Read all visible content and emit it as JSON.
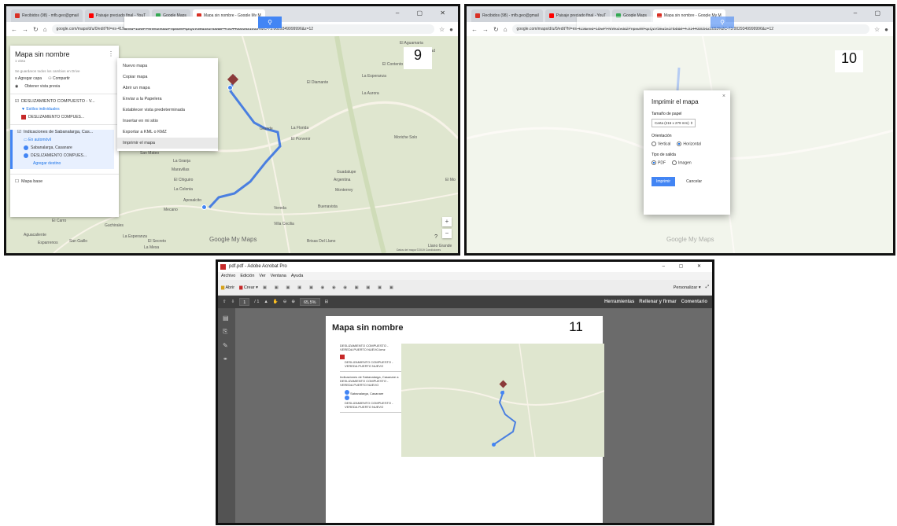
{
  "tabs": {
    "gmail": "Recibidos (98) - mfb.geo@gmail",
    "youtube": "Paisaje preciado final - YouT",
    "maps": "Google Maps",
    "mymaps": "Mapa sin nombre - Google My M"
  },
  "url": "google.com/maps/d/u/0/edit?hl=es-419&mid=1BwPFMWo2vdd2PnpsuWFqzQzV5Eu5s1Hb8&ll=4.91440805621053%2C-73.0029349999996&z=12",
  "shot9": {
    "number": "9",
    "panel": {
      "title": "Mapa sin nombre",
      "views": "1 vista",
      "saved": "Se guardaron todos los cambios en Drive",
      "add_layer": "Agregar capa",
      "share": "Compartir",
      "preview": "Obtener vista previa",
      "layer1": "DESLIZAMIENTO COMPUESTO - V...",
      "layer1_style": "Estilos individuales",
      "layer1_item": "DESLIZAMIENTO COMPUES...",
      "layer2": "Indicaciones de Sabanalarga, Cas...",
      "layer2_mode": "En automóvil",
      "layer2_a": "Sabanalarga, Casanare",
      "layer2_b": "DESLIZAMIENTO COMPUES...",
      "add_dest": "Agregar destino",
      "base": "Mapa base"
    },
    "menu": [
      "Nuevo mapa",
      "Copiar mapa",
      "Abrir un mapa",
      "Enviar a la Papelera",
      "Establecer vista predeterminada",
      "Insertar en mi sitio",
      "Exportar a KML o KMZ",
      "Imprimir el mapa"
    ],
    "map_labels": {
      "aguamaria": "El Aguamaria",
      "contento": "El Contento",
      "esperanza": "La Esperanza",
      "diamante": "El Diamante",
      "aurora": "La Aurora",
      "florida": "La Florida",
      "porvenir": "El Porvenir",
      "morichesolo": "Moriche Solo",
      "sanmateo": "San Mateo",
      "granja": "La Granja",
      "maravillas": "Maravillas",
      "chiquero": "El Chiguiro",
      "colonia": "La Colonia",
      "guadalupe": "Guadalupe",
      "argentina": "Argentina",
      "monterrey": "Monterrey",
      "grande": "Grande",
      "mirador": "Mecano",
      "vereda": "Vereda",
      "buenavista": "Buenavista",
      "elcarro": "El Carro",
      "aguacaliente": "Aguacaliente",
      "esparrenos": "Esparrenos",
      "guchirales": "Guchirales",
      "sangaller": "San Gaillo",
      "lamesa": "La Mesa",
      "secreto": "El Secreto",
      "lasesperanza": "La Esperanza",
      "villacecilia": "Villa Cecilia",
      "brisas": "Brisas Del Llano",
      "llanoverde": "Llano Grande",
      "libertad": "La Libertad",
      "el": "El Mo",
      "aposalcito": "Aposalcito"
    },
    "logo": "Google My Maps",
    "footer": "Datos del mapa ©2019 Condiciones",
    "zoom_plus": "+",
    "zoom_minus": "−",
    "help": "?"
  },
  "shot10": {
    "number": "10",
    "dialog": {
      "title": "Imprimir el mapa",
      "paper_label": "Tamaño de papel",
      "paper_value": "Carta (216 x 279 mm)",
      "orientation_label": "Orientación",
      "vertical": "Vertical",
      "horizontal": "Horizontal",
      "output_label": "Tipo de salida",
      "pdf": "PDF",
      "image": "Imagen",
      "print_btn": "Imprimir",
      "cancel_btn": "Cancelar",
      "close": "×"
    },
    "logo": "Google My Maps"
  },
  "shot11": {
    "number": "11",
    "app_title": "pdf.pdf - Adobe Acrobat Pro",
    "menu": [
      "Archivo",
      "Edición",
      "Ver",
      "Ventana",
      "Ayuda"
    ],
    "open": "Abrir",
    "create": "Crear",
    "customize": "Personalizar",
    "page_current": "1",
    "page_total": "/ 1",
    "zoom": "65,5%",
    "tools": "Herramientas",
    "fill_sign": "Rellenar y firmar",
    "comment": "Comentario",
    "doc_title": "Mapa sin nombre",
    "legend1_title": "DESLIZAMIENTO COMPUESTO - VEREDA PUERTO NUEVO.kmz",
    "legend1_item": "DESLIZAMIENTO COMPUESTO - VEREDA PUERTO NUEVO",
    "legend2_title": "Indicaciones de Sabanalarga, Casanare a DESLIZAMIENTO COMPUESTO - VEREDA PUERTO NUEVO",
    "legend2_a": "Sabanalarga, Casanare",
    "legend2_b": "DESLIZAMIENTO COMPUESTO - VEREDA PUERTO NUEVO"
  },
  "colors": {
    "route": "#4a7fe0",
    "marker": "#8b3a3a",
    "accent": "#4285f4"
  }
}
